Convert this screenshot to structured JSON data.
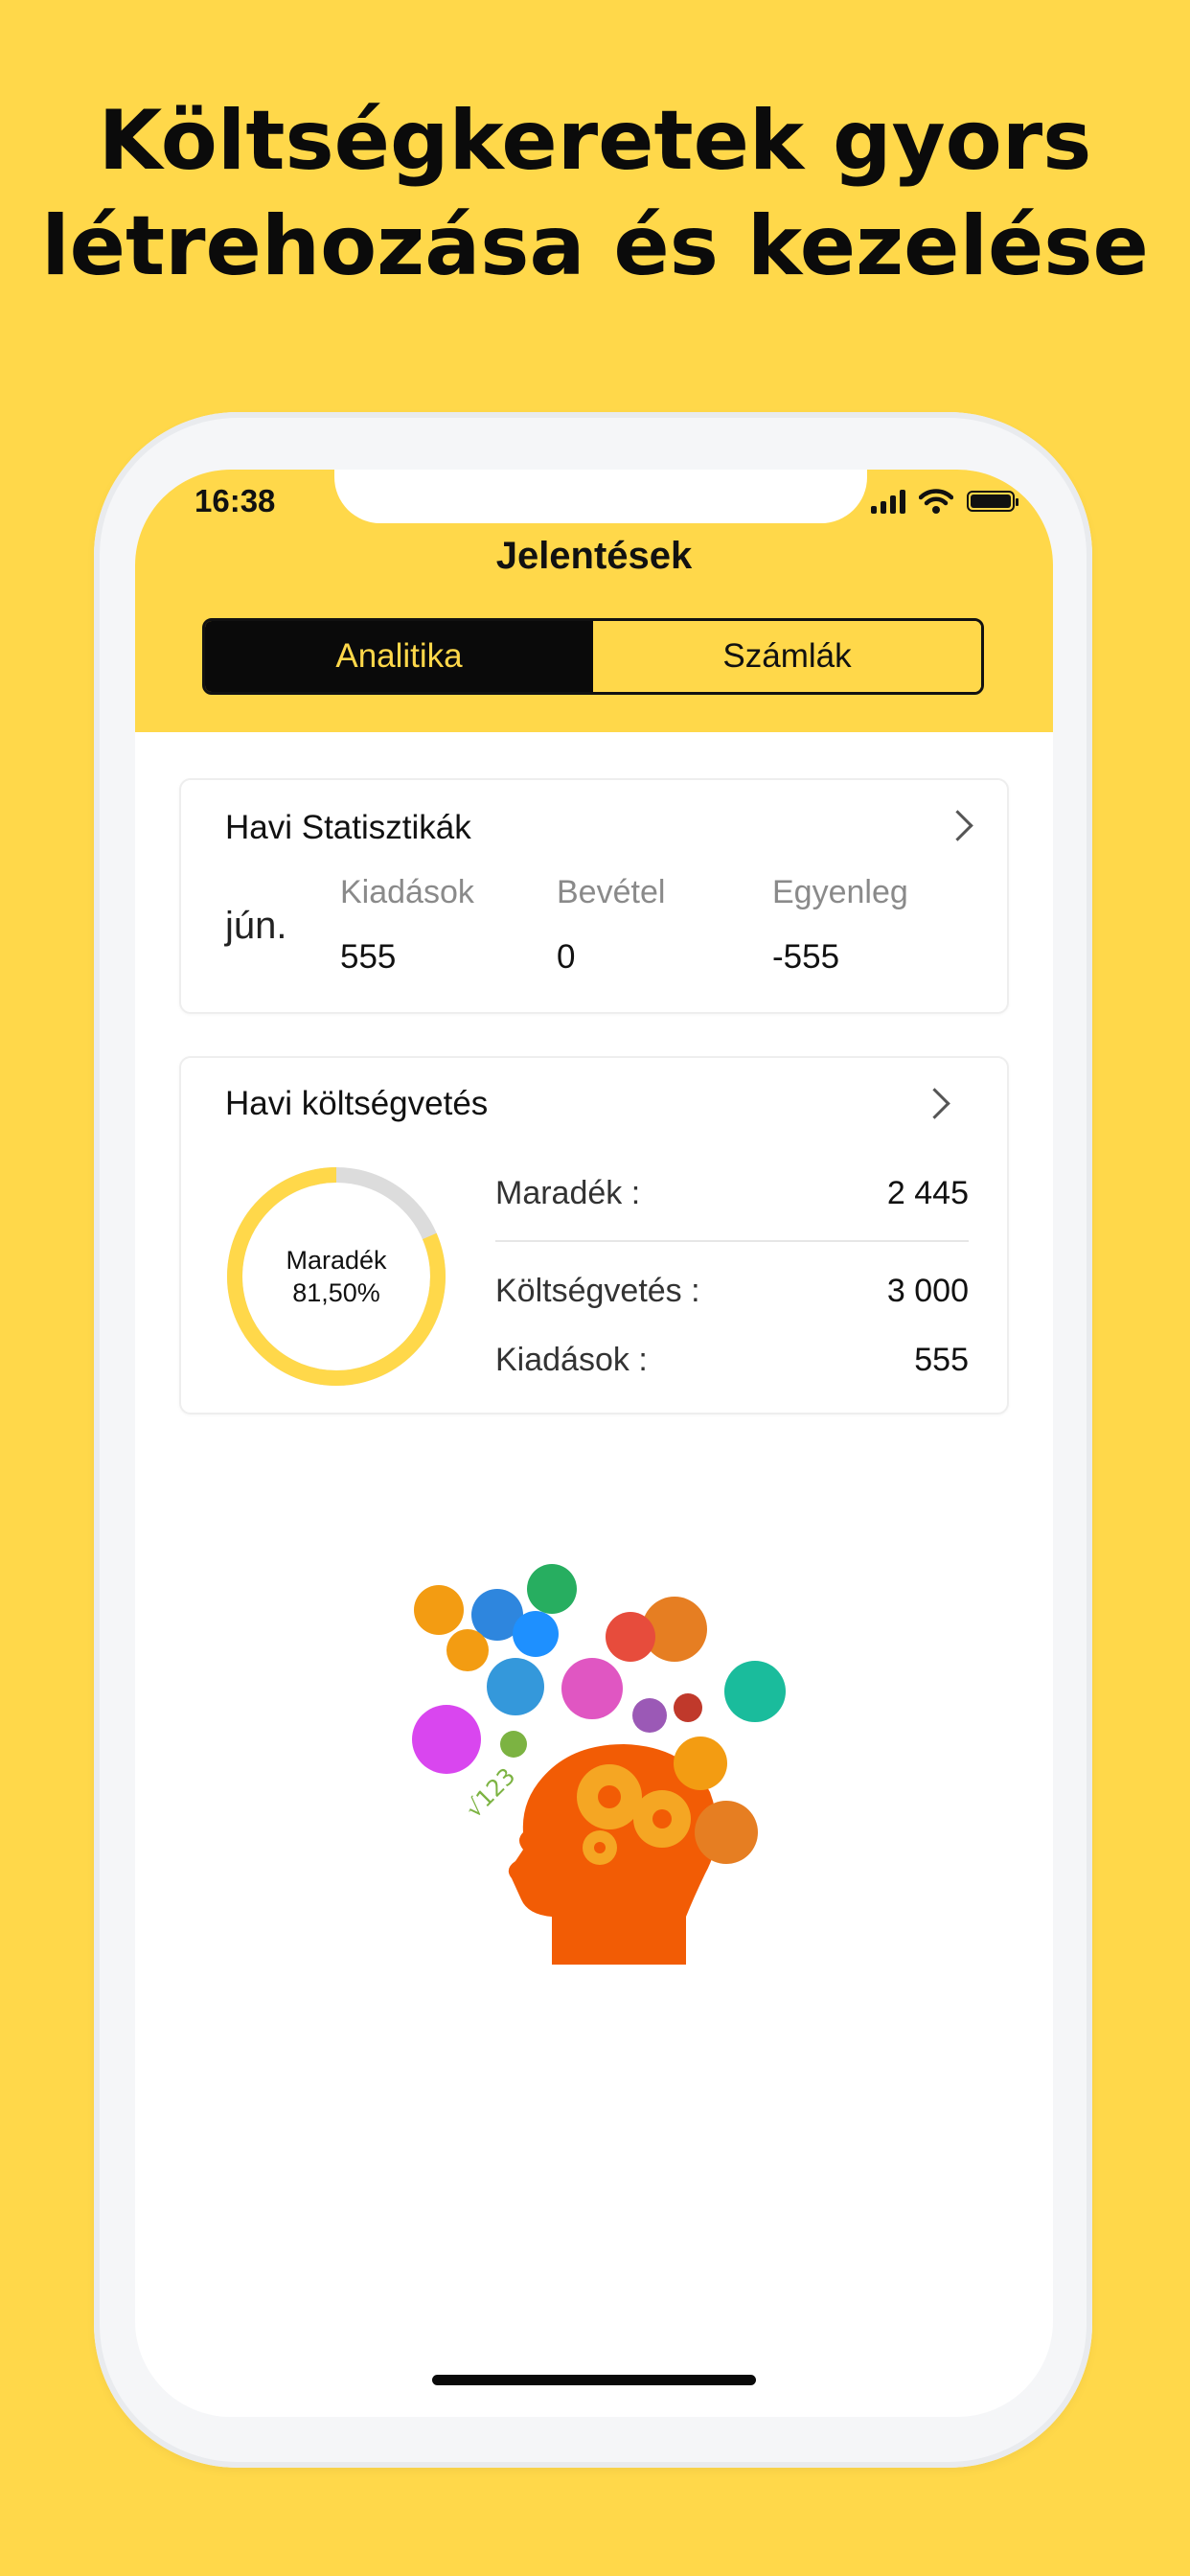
{
  "promo": {
    "line1": "Költségkeretek gyors",
    "line2": "létrehozása és kezelése"
  },
  "status_bar": {
    "time": "16:38",
    "icons": [
      "cellular-signal-icon",
      "wifi-icon",
      "battery-icon"
    ]
  },
  "nav": {
    "title": "Jelentések"
  },
  "tabs": [
    {
      "label": "Analitika",
      "active": true
    },
    {
      "label": "Számlák",
      "active": false
    }
  ],
  "monthly_stats": {
    "title": "Havi Statisztikák",
    "month": "jún.",
    "columns": [
      {
        "label": "Kiadások",
        "value": "555"
      },
      {
        "label": "Bevétel",
        "value": "0"
      },
      {
        "label": "Egyenleg",
        "value": "-555"
      }
    ]
  },
  "monthly_budget": {
    "title": "Havi költségvetés",
    "donut_label": "Maradék",
    "donut_percent_text": "81,50%",
    "remaining_fraction": 0.815,
    "rows": [
      {
        "label": "Maradék :",
        "value": "2 445"
      },
      {
        "label": "Költségvetés :",
        "value": "3 000"
      },
      {
        "label": "Kiadások :",
        "value": "555"
      }
    ]
  },
  "colors": {
    "brand_yellow": "#FFD84A",
    "donut_track": "#DCDCDC",
    "active_tab_bg": "#0A0A0A"
  },
  "illustration": {
    "icon": "head-with-gears-and-science-icons"
  }
}
